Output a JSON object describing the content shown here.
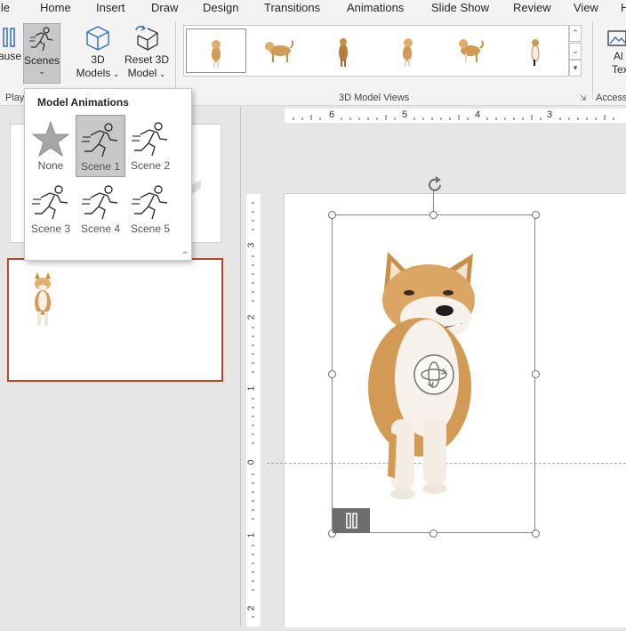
{
  "tabs": [
    "ile",
    "Home",
    "Insert",
    "Draw",
    "Design",
    "Transitions",
    "Animations",
    "Slide Show",
    "Review",
    "View",
    "H"
  ],
  "ribbon": {
    "pause_label": "ause",
    "scenes_label": "Scenes",
    "models_label_1": "3D",
    "models_label_2": "Models",
    "reset_label_1": "Reset 3D",
    "reset_label_2": "Model",
    "right_label_1": "Al",
    "right_label_2": "Tex",
    "group_play": "Play",
    "group_views": "3D Model Views",
    "group_access": "Accessi"
  },
  "dropdown": {
    "title": "Model Animations",
    "items": [
      {
        "label": "None",
        "selected": false
      },
      {
        "label": "Scene 1",
        "selected": true
      },
      {
        "label": "Scene 2",
        "selected": false
      },
      {
        "label": "Scene 3",
        "selected": false
      },
      {
        "label": "Scene 4",
        "selected": false
      },
      {
        "label": "Scene 5",
        "selected": false
      }
    ]
  },
  "ruler": {
    "h_labels": [
      "6",
      "5",
      "4",
      "3"
    ],
    "v_labels": [
      "3",
      "2",
      "1",
      "0",
      "1",
      "2"
    ]
  },
  "colors": {
    "accent_thumb_border": "#b7472a",
    "ribbon_bg": "#f3f3f3",
    "dog_fur": "#c98f45"
  }
}
